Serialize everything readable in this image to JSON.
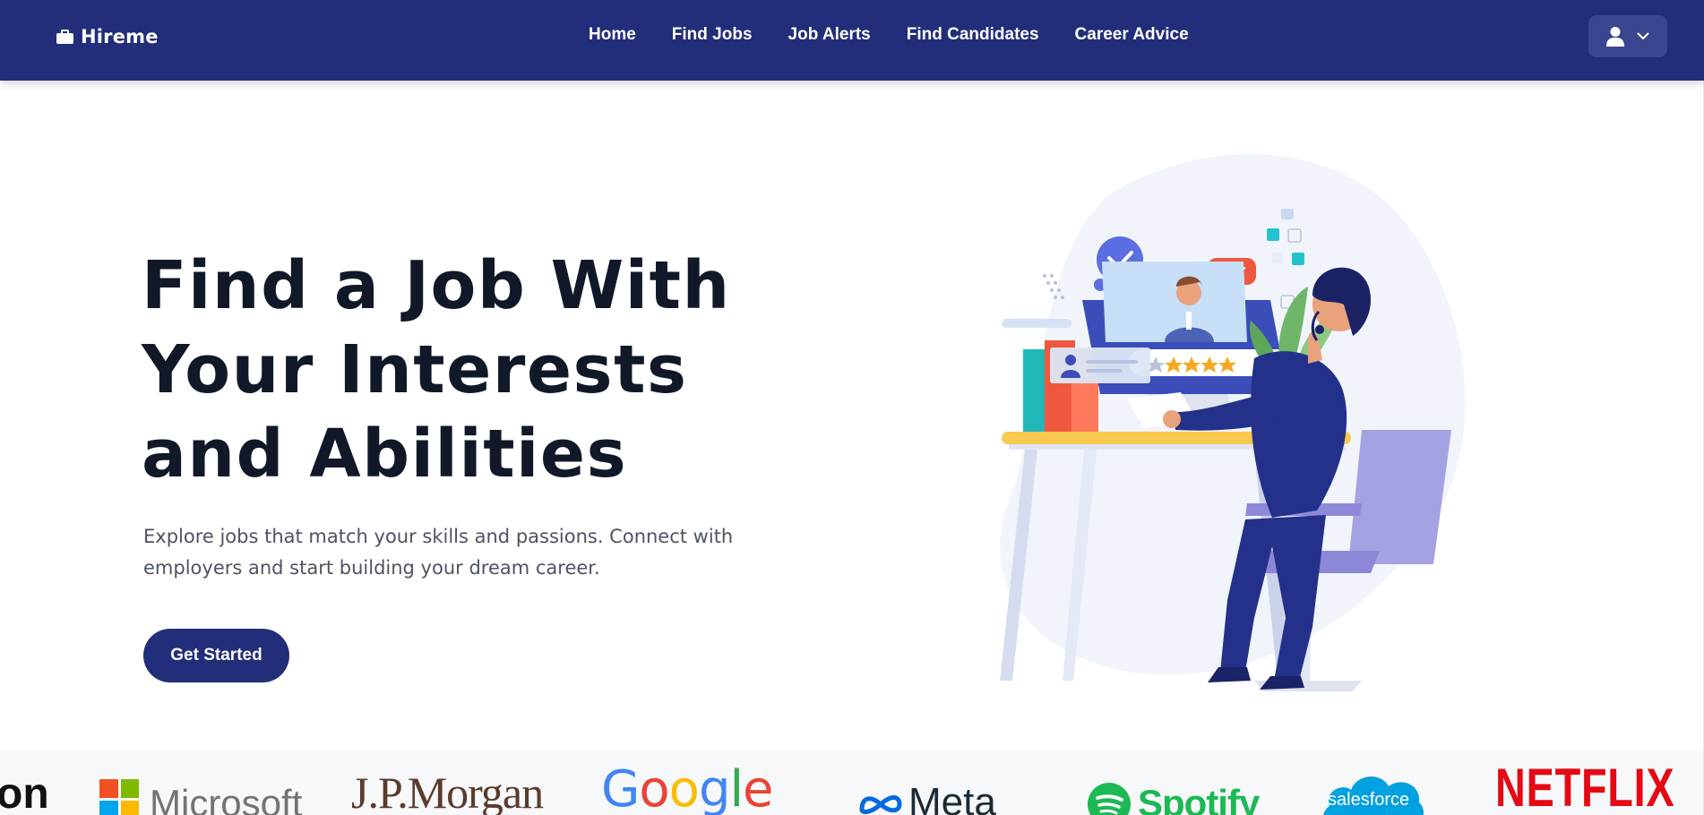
{
  "navbar": {
    "brand": "Hireme",
    "links": [
      {
        "label": "Home"
      },
      {
        "label": "Find Jobs"
      },
      {
        "label": "Job Alerts"
      },
      {
        "label": "Find Candidates"
      },
      {
        "label": "Career Advice"
      }
    ],
    "user_menu_icon": "user-icon",
    "user_menu_chevron": "chevron-down-icon"
  },
  "hero": {
    "title_lines": [
      "Find a Job With",
      "Your Interests",
      "and Abilities"
    ],
    "subtitle": "Explore jobs that match your skills and passions. Connect with employers and start building your dream career.",
    "cta_label": "Get Started"
  },
  "logos": {
    "amazon_partial": "on",
    "microsoft": "Microsoft",
    "jpmorgan": "J.P.Morgan",
    "google": [
      "G",
      "o",
      "o",
      "g",
      "l",
      "e"
    ],
    "meta": "Meta",
    "spotify": "Spotify",
    "salesforce": "salesforce",
    "netflix": "NETFLIX"
  },
  "colors": {
    "brand_navy": "#222e7a",
    "google": [
      "#4285f4",
      "#ea4335",
      "#fbbc05",
      "#4285f4",
      "#34a853",
      "#ea4335"
    ],
    "microsoft": [
      "#f25022",
      "#7fba00",
      "#00a4ef",
      "#ffb900"
    ]
  }
}
